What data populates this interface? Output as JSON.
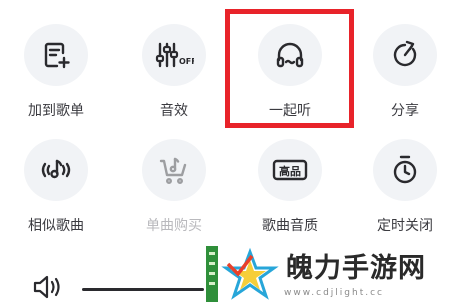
{
  "menu": {
    "row1": [
      {
        "label": "加到歌单",
        "icon": "add-to-playlist-icon"
      },
      {
        "label": "音效",
        "icon": "sound-effect-icon",
        "badge": "OFF"
      },
      {
        "label": "一起听",
        "icon": "headphones-icon"
      },
      {
        "label": "分享",
        "icon": "share-icon"
      }
    ],
    "row2": [
      {
        "label": "相似歌曲",
        "icon": "similar-songs-icon"
      },
      {
        "label": "单曲购买",
        "icon": "shopping-cart-icon",
        "disabled": true
      },
      {
        "label": "歌曲音质",
        "icon": "audio-quality-icon",
        "badge": "高品"
      },
      {
        "label": "定时关闭",
        "icon": "timer-icon"
      }
    ]
  },
  "watermark": {
    "text": "魄力手游网",
    "url": "www.cdjlight.cc"
  },
  "colors": {
    "highlight": "#e8232a",
    "circle_bg": "#f1f3f6",
    "label": "#3b3b40",
    "disabled_label": "#b9b9bd"
  }
}
